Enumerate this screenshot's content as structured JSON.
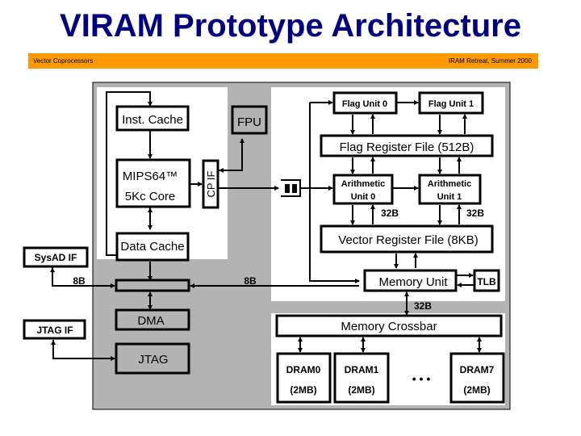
{
  "title": "VIRAM Prototype Architecture",
  "banner": {
    "left": "Vector Coprocessors",
    "right": "IRAM Retreat, Summer 2000"
  },
  "colors": {
    "title": "#000080",
    "banner": "#ff9900",
    "chip": "#b3b3b3"
  },
  "blocks": {
    "inst_cache": "Inst. Cache",
    "fpu": "FPU",
    "mips_line1": "MIPS64™",
    "mips_line2": "5Kc Core",
    "cp_if": "CP IF",
    "data_cache": "Data Cache",
    "sysad_if": "SysAD IF",
    "jtag_if": "JTAG IF",
    "dma": "DMA",
    "jtag": "JTAG",
    "flag_unit_0": "Flag Unit 0",
    "flag_unit_1": "Flag Unit 1",
    "flag_register_file": "Flag Register File (512B)",
    "arith_0_line1": "Arithmetic",
    "arith_0_line2": "Unit 0",
    "arith_1_line1": "Arithmetic",
    "arith_1_line2": "Unit 1",
    "vector_register_file": "Vector Register File (8KB)",
    "memory_unit": "Memory Unit",
    "tlb": "TLB",
    "memory_crossbar": "Memory Crossbar",
    "dram0_line1": "DRAM0",
    "dram0_line2": "(2MB)",
    "dram1_line1": "DRAM1",
    "dram1_line2": "(2MB)",
    "ellipsis": "• • •",
    "dram7_line1": "DRAM7",
    "dram7_line2": "(2MB)"
  },
  "labels": {
    "bw_sysad": "8B",
    "bw_mem": "8B",
    "bw_arith0": "32B",
    "bw_arith1": "32B",
    "bw_crossbar": "32B"
  }
}
